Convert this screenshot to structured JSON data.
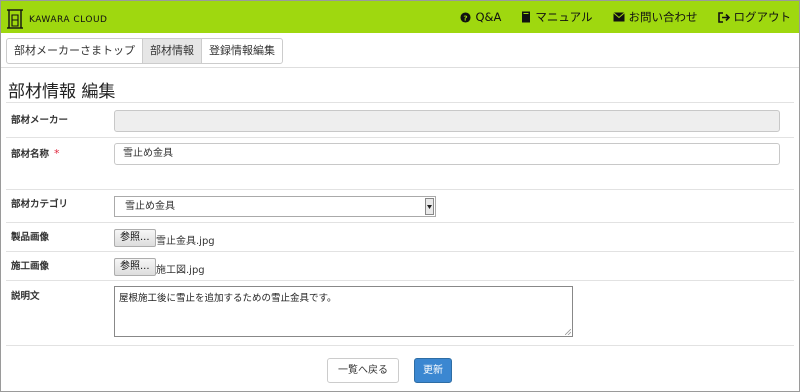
{
  "header": {
    "brand": "KAWARA CLOUD",
    "nav": [
      {
        "label": "Q&A",
        "icon": "question-circle-icon"
      },
      {
        "label": "マニュアル",
        "icon": "book-icon"
      },
      {
        "label": "お問い合わせ",
        "icon": "envelope-icon"
      },
      {
        "label": "ログアウト",
        "icon": "sign-out-icon"
      }
    ],
    "accent_color": "#9fd80f"
  },
  "breadcrumb": [
    "部材メーカーさまトップ",
    "部材情報",
    "登録情報編集"
  ],
  "page_title": "部材情報 編集",
  "form": {
    "maker": {
      "label": "部材メーカー",
      "value": ""
    },
    "name": {
      "label": "部材名称",
      "required_mark": "*",
      "value": "雪止め金具"
    },
    "category": {
      "label": "部材カテゴリ",
      "value": "雪止め金具"
    },
    "product_image": {
      "label": "製品画像",
      "button": "参照...",
      "file": "雪止金具.jpg"
    },
    "construction_image": {
      "label": "施工画像",
      "button": "参照...",
      "file": "施工図.jpg"
    },
    "description": {
      "label": "説明文",
      "value": "屋根施工後に雪止を追加するための雪止金具です。"
    }
  },
  "buttons": {
    "back": "一覧へ戻る",
    "update": "更新"
  }
}
